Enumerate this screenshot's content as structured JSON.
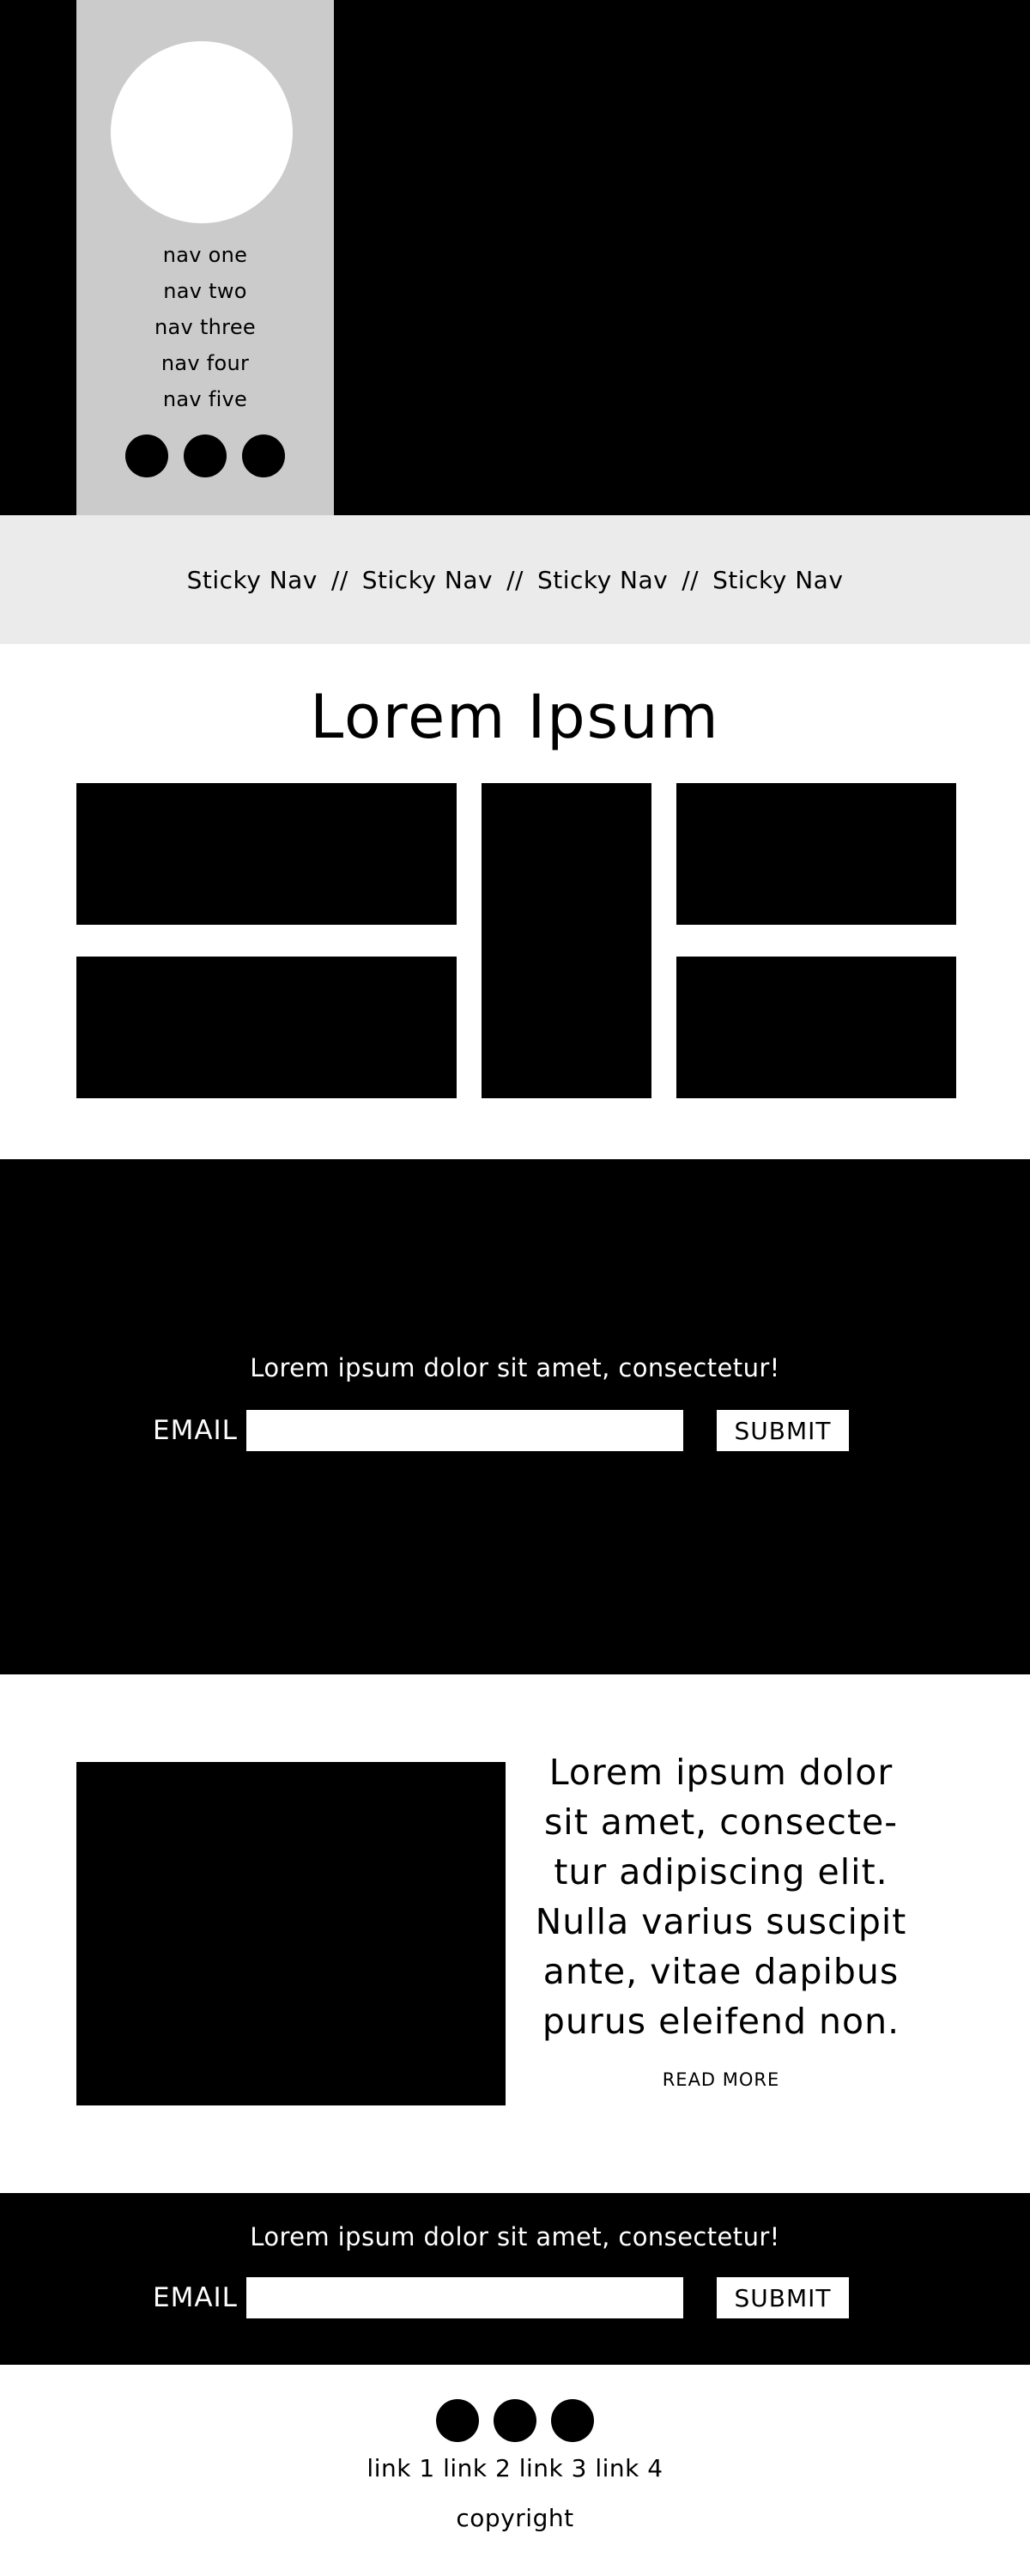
{
  "sidebar": {
    "nav_items": [
      "nav one",
      "nav two",
      "nav three",
      "nav four",
      "nav five"
    ],
    "social_icons": [
      "social-icon-1",
      "social-icon-2",
      "social-icon-3"
    ]
  },
  "sticky_nav": {
    "items": [
      "Sticky Nav",
      "Sticky Nav",
      "Sticky Nav",
      "Sticky Nav"
    ],
    "separator": "//"
  },
  "gallery": {
    "title": "Lorem Ipsum"
  },
  "signup_top": {
    "tagline": "Lorem ipsum dolor sit amet, consectetur!",
    "email_label": "EMAIL",
    "email_value": "",
    "submit_label": "SUBMIT"
  },
  "feature": {
    "text": "Lorem ipsum dolor sit amet, consecte-tur adipiscing elit. Nulla varius suscipit ante, vitae dapibus purus eleifend non.",
    "read_more": "READ MORE"
  },
  "signup_bottom": {
    "tagline": "Lorem ipsum dolor sit amet, consectetur!",
    "email_label": "EMAIL",
    "email_value": "",
    "submit_label": "SUBMIT"
  },
  "footer": {
    "links": [
      "link 1",
      "link 2",
      "link 3",
      "link 4"
    ],
    "copyright": "copyright",
    "social_icons": [
      "social-icon-1",
      "social-icon-2",
      "social-icon-3"
    ]
  },
  "colors": {
    "hero_bg": "#000000",
    "side_panel_bg": "#cbcbcb",
    "sticky_nav_bg": "#ebebeb",
    "placeholder_block": "#000000"
  }
}
